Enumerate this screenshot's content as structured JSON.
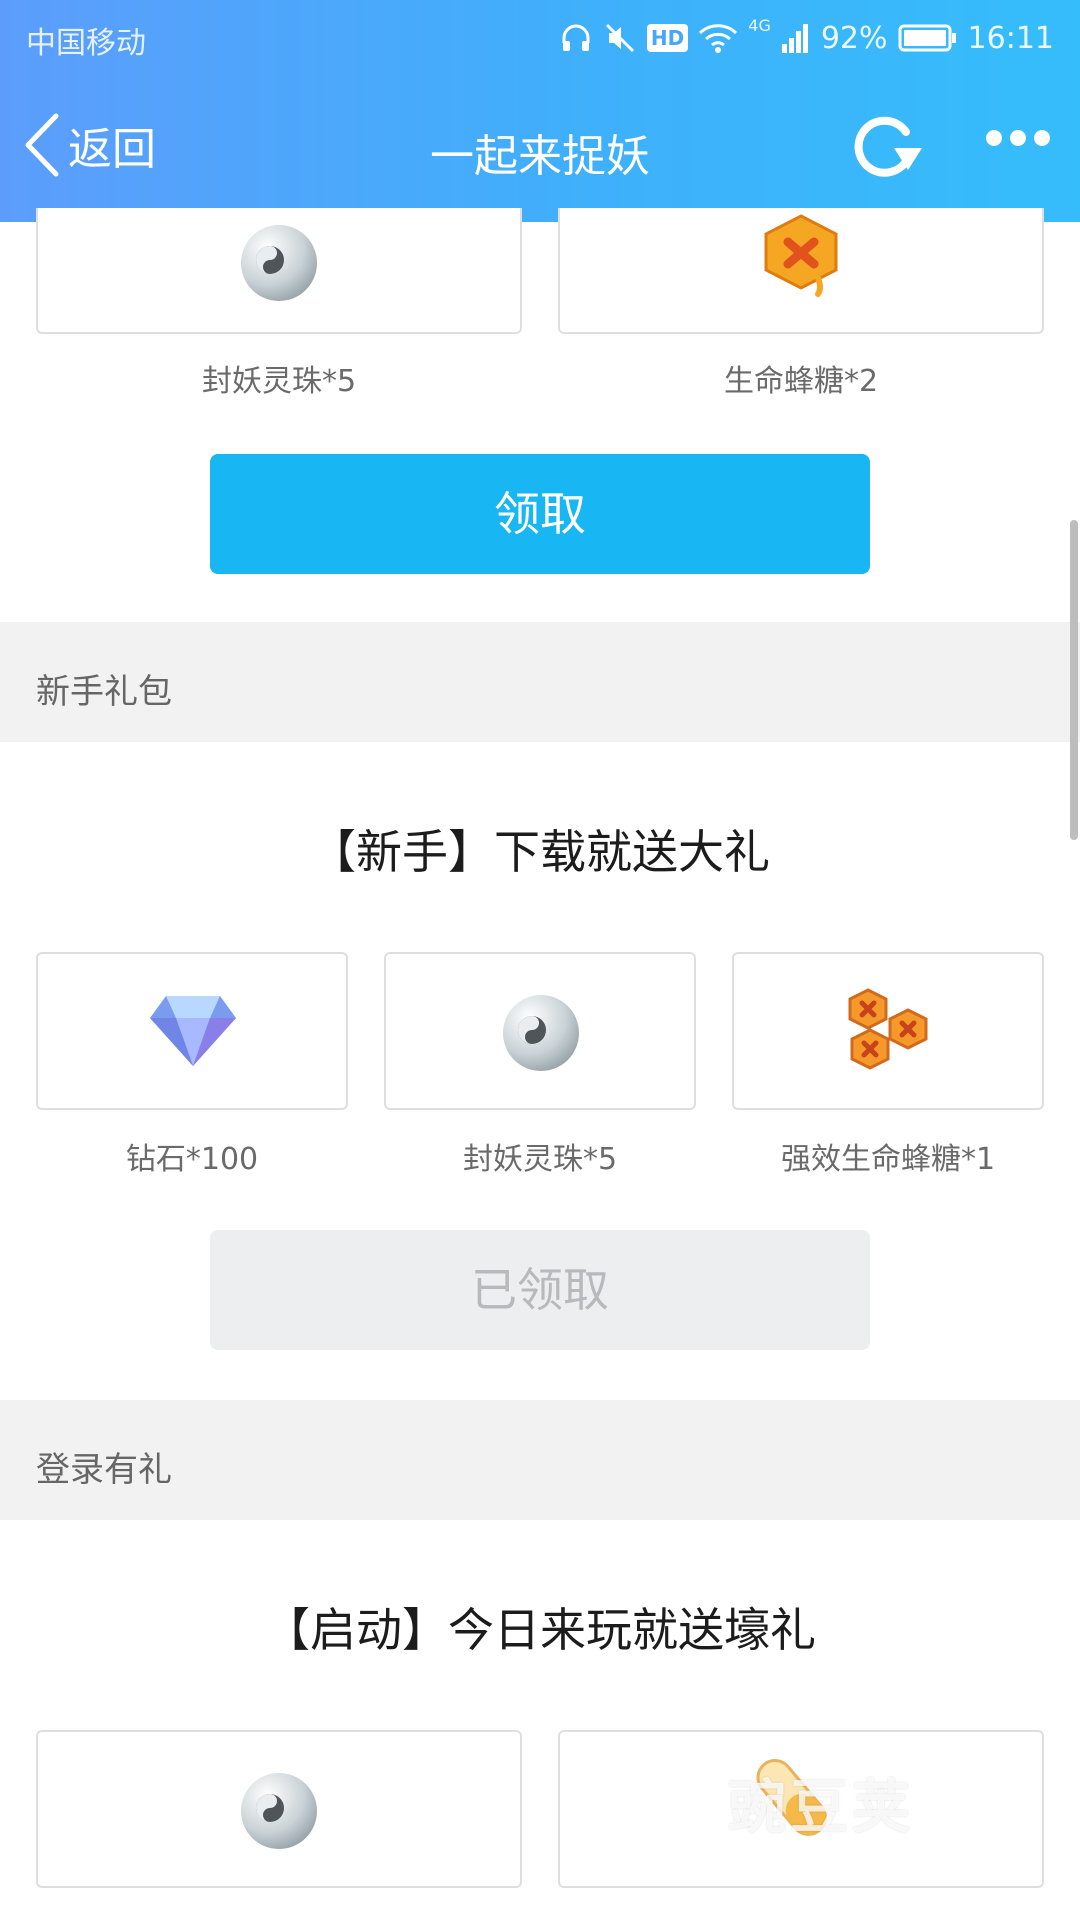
{
  "status_bar": {
    "carrier": "中国移动",
    "hd_badge": "HD",
    "network": "4G",
    "battery": "92%",
    "time": "16:11"
  },
  "nav": {
    "back_label": "返回",
    "title": "一起来捉妖"
  },
  "top_section": {
    "items": [
      {
        "label": "封妖灵珠*5",
        "icon": "yin-yang-orb-icon"
      },
      {
        "label": "生命蜂糖*2",
        "icon": "honey-candy-icon"
      }
    ],
    "claim_button": "领取"
  },
  "newbie_section": {
    "header": "新手礼包",
    "gift_title": "【新手】下载就送大礼",
    "items": [
      {
        "label": "钻石*100",
        "icon": "diamond-icon"
      },
      {
        "label": "封妖灵珠*5",
        "icon": "yin-yang-orb-icon"
      },
      {
        "label": "强效生命蜂糖*1",
        "icon": "honeycomb-candy-icon"
      }
    ],
    "claimed_button": "已领取"
  },
  "login_section": {
    "header": "登录有礼",
    "gift_title": "【启动】今日来玩就送壕礼",
    "items": [
      {
        "icon": "yin-yang-orb-icon"
      },
      {
        "icon": "potion-capsule-icon"
      }
    ]
  },
  "watermark": "豌豆荚",
  "colors": {
    "primary_button": "#18b6f3",
    "header_gradient_start": "#5c9dfb",
    "header_gradient_end": "#35bdfb",
    "section_bg": "#f2f2f2"
  }
}
